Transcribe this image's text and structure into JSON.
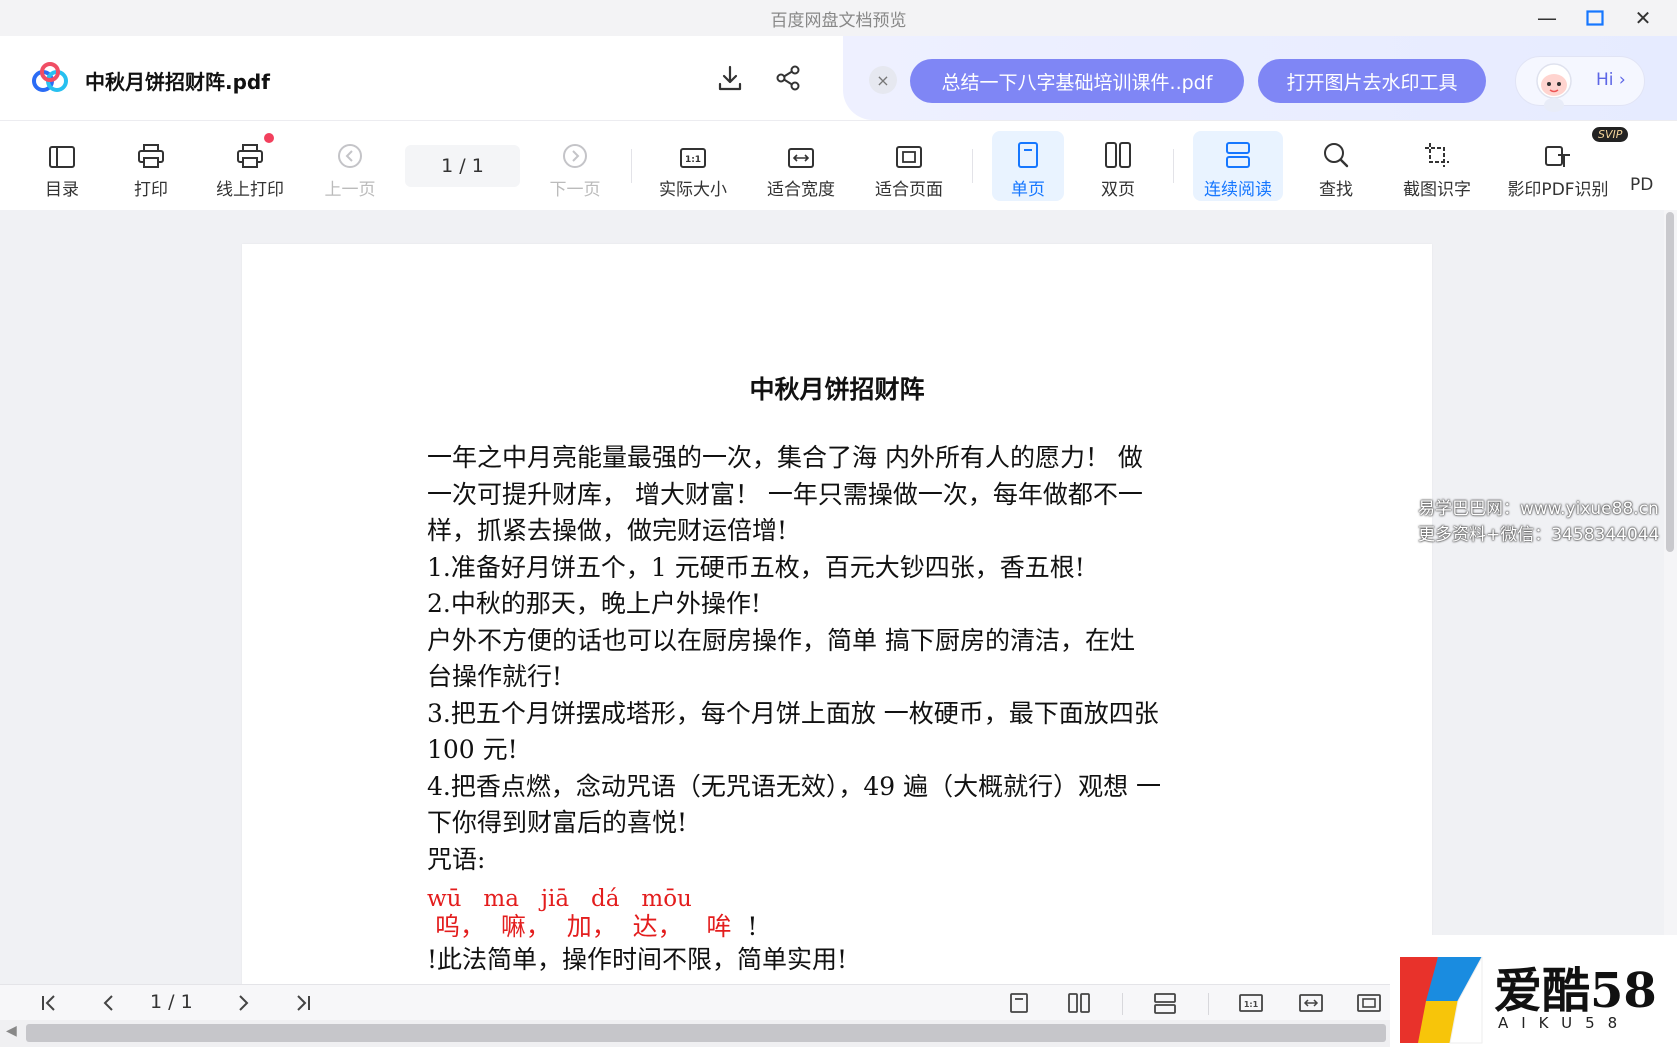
{
  "window": {
    "title": "百度网盘文档预览",
    "minimize_symbol": "—",
    "maximize_symbol": "☐",
    "close_symbol": "✕"
  },
  "header": {
    "doc_name": "中秋月饼招财阵.pdf",
    "download_icon": "download-icon",
    "share_icon": "share-icon",
    "promo_close": "×",
    "promo_pill_1": "总结一下八字基础培训课件..pdf",
    "promo_pill_2": "打开图片去水印工具",
    "hi_label": "Hi ›"
  },
  "toolbar": {
    "toc": "目录",
    "print": "打印",
    "online_print": "线上打印",
    "prev_page": "上一页",
    "page_indicator": "1 / 1",
    "next_page": "下一页",
    "actual_size": "实际大小",
    "fit_width": "适合宽度",
    "fit_page": "适合页面",
    "single_page": "单页",
    "double_page": "双页",
    "continuous": "连续阅读",
    "find": "查找",
    "ocr": "截图识字",
    "scan_pdf": "影印PDF识别",
    "svip_badge": "SVIP",
    "more": "PD"
  },
  "document": {
    "title": "中秋月饼招财阵",
    "lines": [
      "一年之中月亮能量最强的一次，集合了海 内外所有人的愿力！ 做",
      "一次可提升财库， 增大财富！ 一年只需操做一次，每年做都不一",
      "样，抓紧去操做，做完财运倍增!",
      "1.准备好月饼五个，1  元硬币五枚，百元大钞四张，香五根!",
      "2.中秋的那天，晚上户外操作!",
      "户外不方便的话也可以在厨房操作，简单 搞下厨房的清洁，在灶",
      "台操作就行!",
      "3.把五个月饼摆成塔形，每个月饼上面放 一枚硬币，最下面放四张",
      "100  元!",
      "4.把香点燃，念动咒语（无咒语无效），49  遍（大概就行）观想 一",
      "下你得到财富后的喜悦!",
      "咒语:"
    ],
    "pinyin": "wū   ma   jiā   dá   mōu",
    "mantra": " 呜，  嘛，  加，  达，   哞",
    "mantra_end": "  !",
    "after": [
      "!此法简单，操作时间不限，简单实用!"
    ]
  },
  "watermark": {
    "line1": "易学巴巴网：www.yixue88.cn",
    "line2": "更多资料+微信：3458344044"
  },
  "bottombar": {
    "page_indicator": "1 / 1"
  },
  "brand": {
    "name": "爱酷58",
    "sub": "AIKU58"
  },
  "colors": {
    "accent": "#1677ff",
    "promo_pill": "#7f86f5",
    "mantra_red": "#e31d1d"
  }
}
